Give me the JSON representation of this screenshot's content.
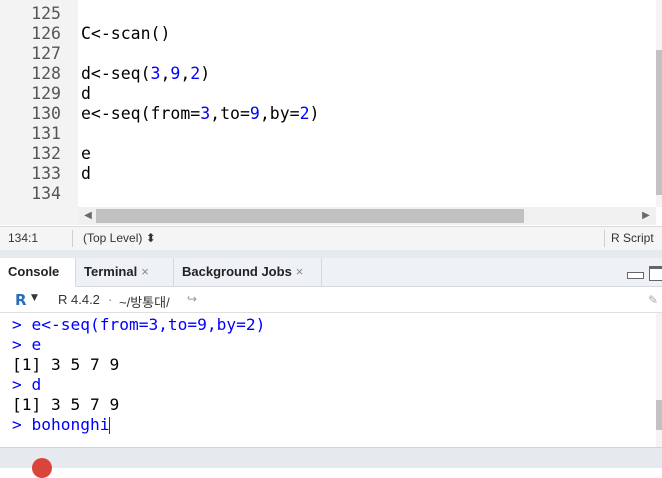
{
  "editor": {
    "lines": [
      {
        "num": "125",
        "code": []
      },
      {
        "num": "126",
        "code": [
          {
            "t": "C<-scan()",
            "c": "op"
          }
        ]
      },
      {
        "num": "127",
        "code": []
      },
      {
        "num": "128",
        "code": [
          {
            "t": "d<-seq(",
            "c": "op"
          },
          {
            "t": "3",
            "c": "num"
          },
          {
            "t": ",",
            "c": "op"
          },
          {
            "t": "9",
            "c": "num"
          },
          {
            "t": ",",
            "c": "op"
          },
          {
            "t": "2",
            "c": "num"
          },
          {
            "t": ")",
            "c": "op"
          }
        ]
      },
      {
        "num": "129",
        "code": [
          {
            "t": "d",
            "c": "op"
          }
        ]
      },
      {
        "num": "130",
        "code": [
          {
            "t": "e<-seq(from=",
            "c": "op"
          },
          {
            "t": "3",
            "c": "num"
          },
          {
            "t": ",to=",
            "c": "op"
          },
          {
            "t": "9",
            "c": "num"
          },
          {
            "t": ",by=",
            "c": "op"
          },
          {
            "t": "2",
            "c": "num"
          },
          {
            "t": ")",
            "c": "op"
          }
        ]
      },
      {
        "num": "131",
        "code": []
      },
      {
        "num": "132",
        "code": [
          {
            "t": "e",
            "c": "op"
          }
        ]
      },
      {
        "num": "133",
        "code": [
          {
            "t": "d",
            "c": "op"
          }
        ]
      },
      {
        "num": "134",
        "code": []
      }
    ]
  },
  "statusbar": {
    "position": "134:1",
    "scope": "(Top Level) ⬍",
    "file_type": "R Script"
  },
  "tabs": [
    {
      "label": "Console",
      "closable": false,
      "active": true
    },
    {
      "label": "Terminal",
      "closable": true,
      "active": false
    },
    {
      "label": "Background Jobs",
      "closable": true,
      "active": false
    }
  ],
  "close_glyph": "×",
  "console_header": {
    "r_logo": "R",
    "r_version": "R 4.4.2",
    "separator": "·",
    "path": "~/방통대/",
    "goto_icon": "↪"
  },
  "console": {
    "lines": [
      {
        "text": "> e<-seq(from=3,to=9,by=2)",
        "kind": "in"
      },
      {
        "text": "> e",
        "kind": "in"
      },
      {
        "text": "[1] 3 5 7 9",
        "kind": "out"
      },
      {
        "text": "> d",
        "kind": "in"
      },
      {
        "text": "[1] 3 5 7 9",
        "kind": "out"
      },
      {
        "text": "> bohonghi",
        "kind": "in"
      }
    ]
  },
  "colors": {
    "accent": "#2a6ebb",
    "console_input": "#0000ff",
    "number": "#0000ff"
  }
}
